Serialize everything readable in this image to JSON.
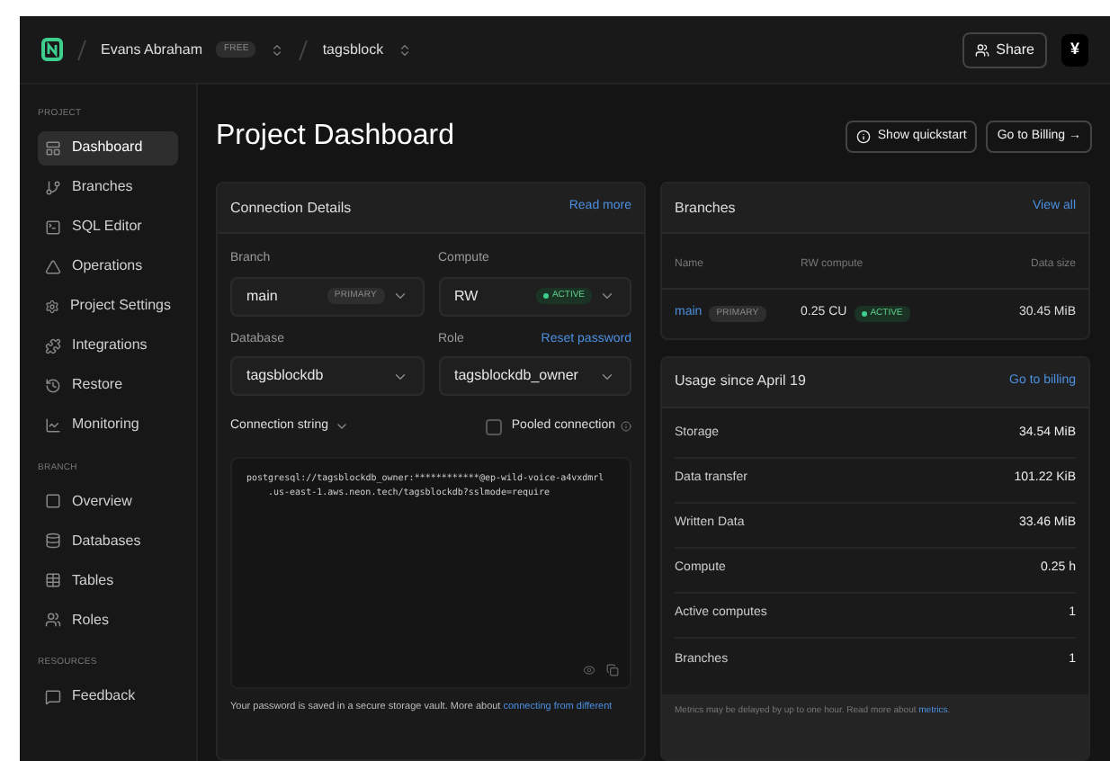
{
  "header": {
    "org": "Evans Abraham",
    "plan": "FREE",
    "project": "tagsblock",
    "share": "Share",
    "avatar": "¥"
  },
  "sidebar": [
    {
      "heading": "PROJECT",
      "items": [
        {
          "label": "Dashboard",
          "selected": true
        },
        {
          "label": "Branches",
          "selected": false
        },
        {
          "label": "SQL Editor",
          "selected": false
        },
        {
          "label": "Operations",
          "selected": false
        },
        {
          "label": "Project Settings",
          "selected": false
        },
        {
          "label": "Integrations",
          "selected": false
        },
        {
          "label": "Restore",
          "selected": false
        },
        {
          "label": "Monitoring",
          "selected": false
        }
      ]
    },
    {
      "heading": "BRANCH",
      "items": [
        {
          "label": "Overview",
          "selected": false
        },
        {
          "label": "Databases",
          "selected": false
        },
        {
          "label": "Tables",
          "selected": false
        },
        {
          "label": "Roles",
          "selected": false
        }
      ]
    },
    {
      "heading": "RESOURCES",
      "items": [
        {
          "label": "Feedback",
          "selected": false
        }
      ]
    }
  ],
  "page": {
    "title": "Project Dashboard",
    "quickstart": "Show quickstart",
    "billing": "Go to Billing →"
  },
  "connection": {
    "title": "Connection Details",
    "link": "Read more",
    "branch": {
      "label": "Branch",
      "value": "main",
      "badge": "PRIMARY"
    },
    "compute": {
      "label": "Compute",
      "value": "RW",
      "status": "ACTIVE"
    },
    "database": {
      "label": "Database",
      "value": "tagsblockdb"
    },
    "role": {
      "label": "Role",
      "value": "tagsblockdb_owner",
      "link": "Reset password"
    },
    "string_label": "Connection string",
    "pooled": {
      "label": "Pooled connection",
      "checked": false
    },
    "string_lines": [
      "postgresql://tagsblockdb_owner:************@ep-wild-voice-a4vxdmrl",
      ".us-east-1.aws.neon.tech/tagsblockdb?sslmode=require"
    ],
    "note": "Your password is saved in a secure storage vault. More about ",
    "note_link": "connecting from different"
  },
  "branches": {
    "title": "Branches",
    "link": "View all",
    "columns": [
      "Name",
      "RW compute",
      "Data size"
    ],
    "rows": [
      {
        "name": "main",
        "badge": "PRIMARY",
        "compute": "0.25 CU",
        "status": "ACTIVE",
        "size": "30.45 MiB"
      }
    ]
  },
  "usage": {
    "title": "Usage since April 19",
    "link": "Go to billing",
    "rows": [
      {
        "label": "Storage",
        "value": "34.54 MiB"
      },
      {
        "label": "Data transfer",
        "value": "101.22 KiB"
      },
      {
        "label": "Written Data",
        "value": "33.46 MiB"
      },
      {
        "label": "Compute",
        "value": "0.25 h"
      },
      {
        "label": "Active computes",
        "value": "1"
      },
      {
        "label": "Branches",
        "value": "1"
      }
    ],
    "note": "Metrics may be delayed by up to one hour. Read more about ",
    "note_link": "metrics",
    "note_end": "."
  }
}
